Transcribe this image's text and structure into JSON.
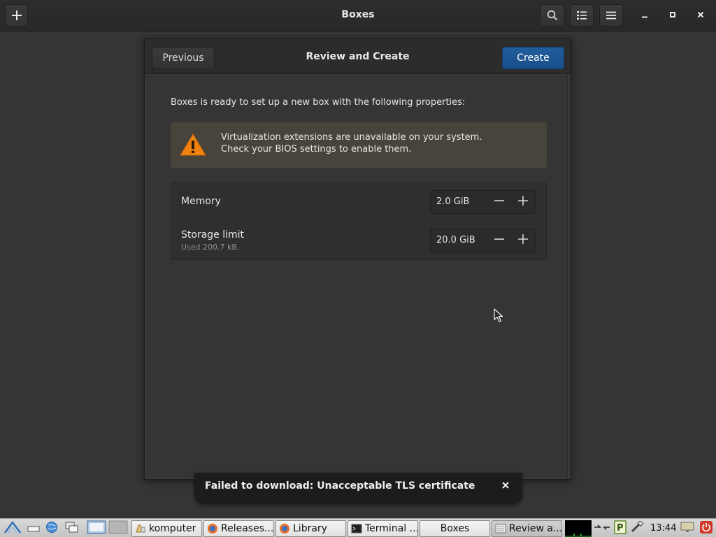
{
  "window": {
    "title": "Boxes",
    "new_icon": "plus-icon",
    "search_icon": "search-icon",
    "view_icon": "list-view-icon",
    "menu_icon": "hamburger-menu-icon",
    "minimize_icon": "minimize-icon",
    "maximize_icon": "maximize-icon",
    "close_icon": "close-icon"
  },
  "dialog": {
    "title": "Review and Create",
    "previous_label": "Previous",
    "create_label": "Create",
    "intro": "Boxes is ready to set up a new box with the following properties:",
    "warning": {
      "icon": "warning-icon",
      "line1": "Virtualization extensions are unavailable on your system.",
      "line2": "Check your BIOS settings to enable them."
    },
    "properties": [
      {
        "label": "Memory",
        "sublabel": "",
        "value": "2.0 GiB"
      },
      {
        "label": "Storage limit",
        "sublabel": "Used 200.7 kB.",
        "value": "20.0 GiB"
      }
    ]
  },
  "notification": {
    "text": "Failed to download: Unacceptable TLS certificate",
    "close_icon": "close-icon"
  },
  "taskbar": {
    "tasks": [
      {
        "label": "komputer",
        "icon": "folder-icon"
      },
      {
        "label": "Releases...",
        "icon": "firefox-icon"
      },
      {
        "label": "Library",
        "icon": "firefox-icon"
      },
      {
        "label": "Terminal ...",
        "icon": "terminal-icon"
      },
      {
        "label": "Boxes",
        "icon": ""
      },
      {
        "label": "Review a...",
        "icon": "window-icon"
      }
    ],
    "clock": "13:44"
  },
  "colors": {
    "accent": "#1a4f8a",
    "background": "#353535",
    "warning_bg": "#48443c",
    "warning_icon": "#f0830f"
  }
}
